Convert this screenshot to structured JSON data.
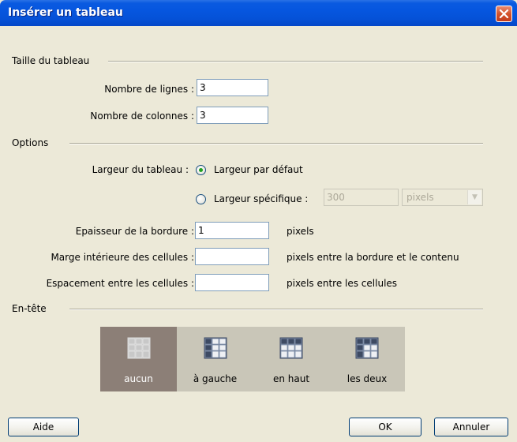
{
  "window": {
    "title": "Insérer un tableau"
  },
  "sections": {
    "taille": "Taille du tableau",
    "options": "Options",
    "entete": "En-tête"
  },
  "taille": {
    "lignes_label": "Nombre de lignes :",
    "lignes_value": "3",
    "colonnes_label": "Nombre de colonnes :",
    "colonnes_value": "3"
  },
  "options": {
    "largeur_label": "Largeur du tableau :",
    "radio_defaut": "Largeur par défaut",
    "radio_specifique": "Largeur spécifique :",
    "largeur_value": "300",
    "unite_select": "pixels",
    "bordure_label": "Epaisseur de la bordure :",
    "bordure_value": "1",
    "bordure_unit": "pixels",
    "marge_label": "Marge intérieure des cellules :",
    "marge_value": "",
    "marge_unit": "pixels entre la bordure et le contenu",
    "espacement_label": "Espacement entre les cellules :",
    "espacement_value": "",
    "espacement_unit": "pixels entre les cellules"
  },
  "entete": {
    "options": [
      {
        "label": "aucun",
        "selected": true
      },
      {
        "label": "à gauche",
        "selected": false
      },
      {
        "label": "en haut",
        "selected": false
      },
      {
        "label": "les deux",
        "selected": false
      }
    ]
  },
  "buttons": {
    "aide": "Aide",
    "ok": "OK",
    "annuler": "Annuler"
  },
  "colors": {
    "titlebar": "#0554d8",
    "dialog_bg": "#ECE9D8",
    "selected_header": "#8c7f77",
    "header_bg": "#c9c6b8"
  }
}
